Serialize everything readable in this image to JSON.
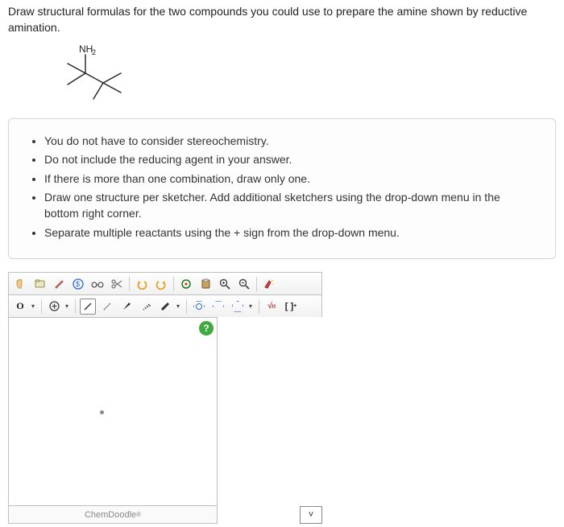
{
  "question": {
    "stem": "Draw structural formulas for the two compounds you could use to prepare the amine shown by reductive amination.",
    "nh2_label": "NH₂"
  },
  "instructions": {
    "items": [
      "You do not have to consider stereochemistry.",
      "Do not include the reducing agent in your answer.",
      "If there is more than one combination, draw only one.",
      "Draw one structure per sketcher. Add additional sketchers using the drop-down menu in the bottom right corner.",
      "Separate multiple reactants using the + sign from the drop-down menu."
    ]
  },
  "toolbar": {
    "hand": "✋",
    "save": "💾",
    "edit": "✎",
    "usd": "⊛",
    "glasses": "👓",
    "scissors": "✂",
    "undo": "↶",
    "redo": "↷",
    "target": "◎",
    "paste": "📋",
    "zoom_in": "🔍",
    "zoom_out": "🔎",
    "clean": "✨"
  },
  "subtool": {
    "atom_O": "O",
    "plus_circle": "⊕",
    "bond_single": "／",
    "bond_dashed": "⋰",
    "bond_wedge": "▲",
    "bond_wavy": "〰",
    "bond_thick": "▰",
    "dd": "▾",
    "charge_label": "√n",
    "bracket": "[ ]",
    "bracket_plus": "⁺"
  },
  "help_btn": "?",
  "footer_brand": "ChemDoodle",
  "footer_reg": "®",
  "corner_dd": "˅"
}
